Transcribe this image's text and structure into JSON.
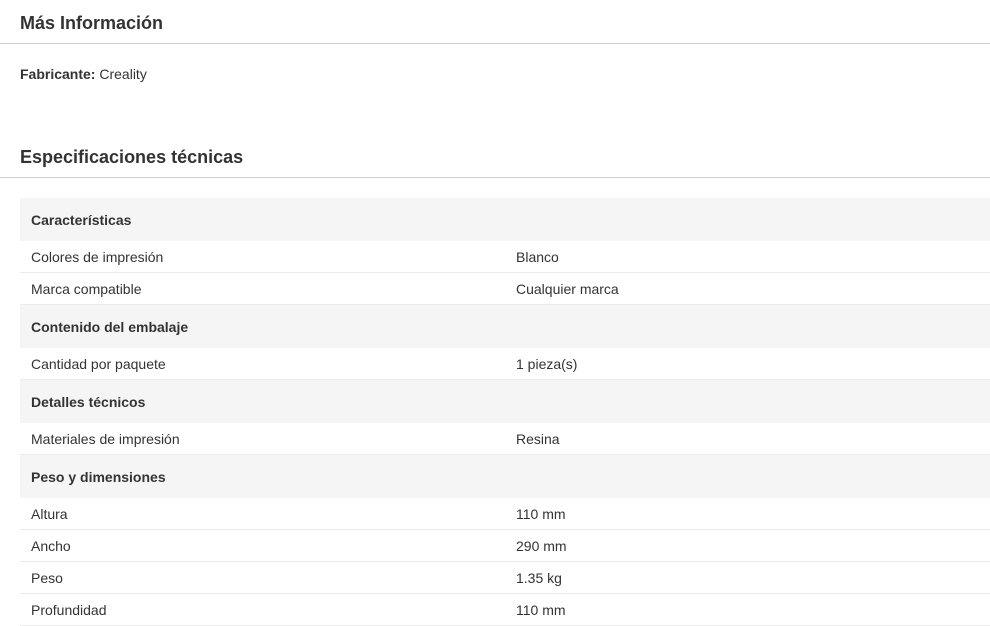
{
  "more_info": {
    "title": "Más Información",
    "manufacturer_label": "Fabricante:",
    "manufacturer_value": "Creality"
  },
  "specs": {
    "title": "Especificaciones técnicas",
    "groups": [
      {
        "name": "Características",
        "rows": [
          {
            "key": "Colores de impresión",
            "value": "Blanco"
          },
          {
            "key": "Marca compatible",
            "value": "Cualquier marca"
          }
        ]
      },
      {
        "name": "Contenido del embalaje",
        "rows": [
          {
            "key": "Cantidad por paquete",
            "value": "1 pieza(s)"
          }
        ]
      },
      {
        "name": "Detalles técnicos",
        "rows": [
          {
            "key": "Materiales de impresión",
            "value": "Resina"
          }
        ]
      },
      {
        "name": "Peso y dimensiones",
        "rows": [
          {
            "key": "Altura",
            "value": "110 mm"
          },
          {
            "key": "Ancho",
            "value": "290 mm"
          },
          {
            "key": "Peso",
            "value": "1.35 kg"
          },
          {
            "key": "Profundidad",
            "value": "110 mm"
          }
        ]
      }
    ]
  }
}
